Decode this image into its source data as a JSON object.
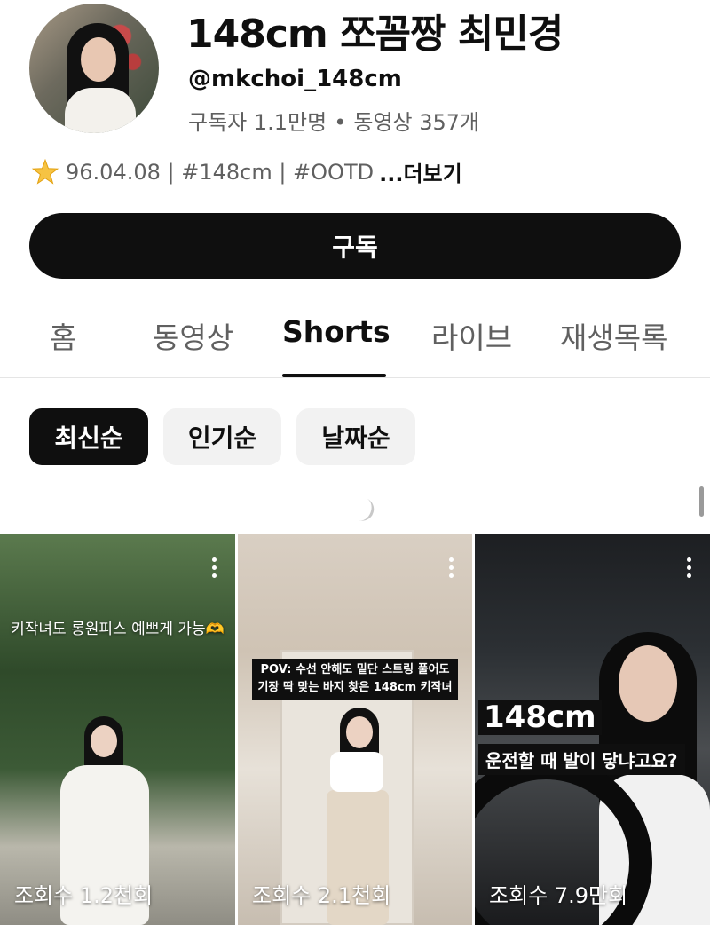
{
  "profile": {
    "channel_name": "148cm 쪼꼼짱 최민경",
    "handle": "@mkchoi_148cm",
    "subscribers": "구독자 1.1만명",
    "separator": "•",
    "videos": "동영상 357개",
    "bio": "96.04.08 | #148cm | #OOTD",
    "bio_more": "...더보기",
    "bio_icon": "star-icon"
  },
  "subscribe_label": "구독",
  "tabs": [
    {
      "label": "홈",
      "active": false
    },
    {
      "label": "동영상",
      "active": false
    },
    {
      "label": "Shorts",
      "active": true
    },
    {
      "label": "라이브",
      "active": false
    },
    {
      "label": "재생목록",
      "active": false
    }
  ],
  "sort_chips": [
    {
      "label": "최신순",
      "active": true
    },
    {
      "label": "인기순",
      "active": false
    },
    {
      "label": "날짜순",
      "active": false
    }
  ],
  "shorts": [
    {
      "overlay": "키작녀도 롱원피스 예쁘게 가능🫶",
      "views": "조회수 1.2천회"
    },
    {
      "overlay_line1": "POV: 수선 안해도 밑단 스트링 풀어도",
      "overlay_line2": "기장 딱 맞는 바지 찾은 148cm 키작녀",
      "views": "조회수 2.1천회"
    },
    {
      "overlay_big": "148cm",
      "overlay_sub": "운전할 때 발이 닿냐고요?",
      "views": "조회수 7.9만회"
    }
  ],
  "colors": {
    "accent": "#0f0f0f",
    "secondary_text": "#606060",
    "chip_bg": "#f2f2f2"
  }
}
